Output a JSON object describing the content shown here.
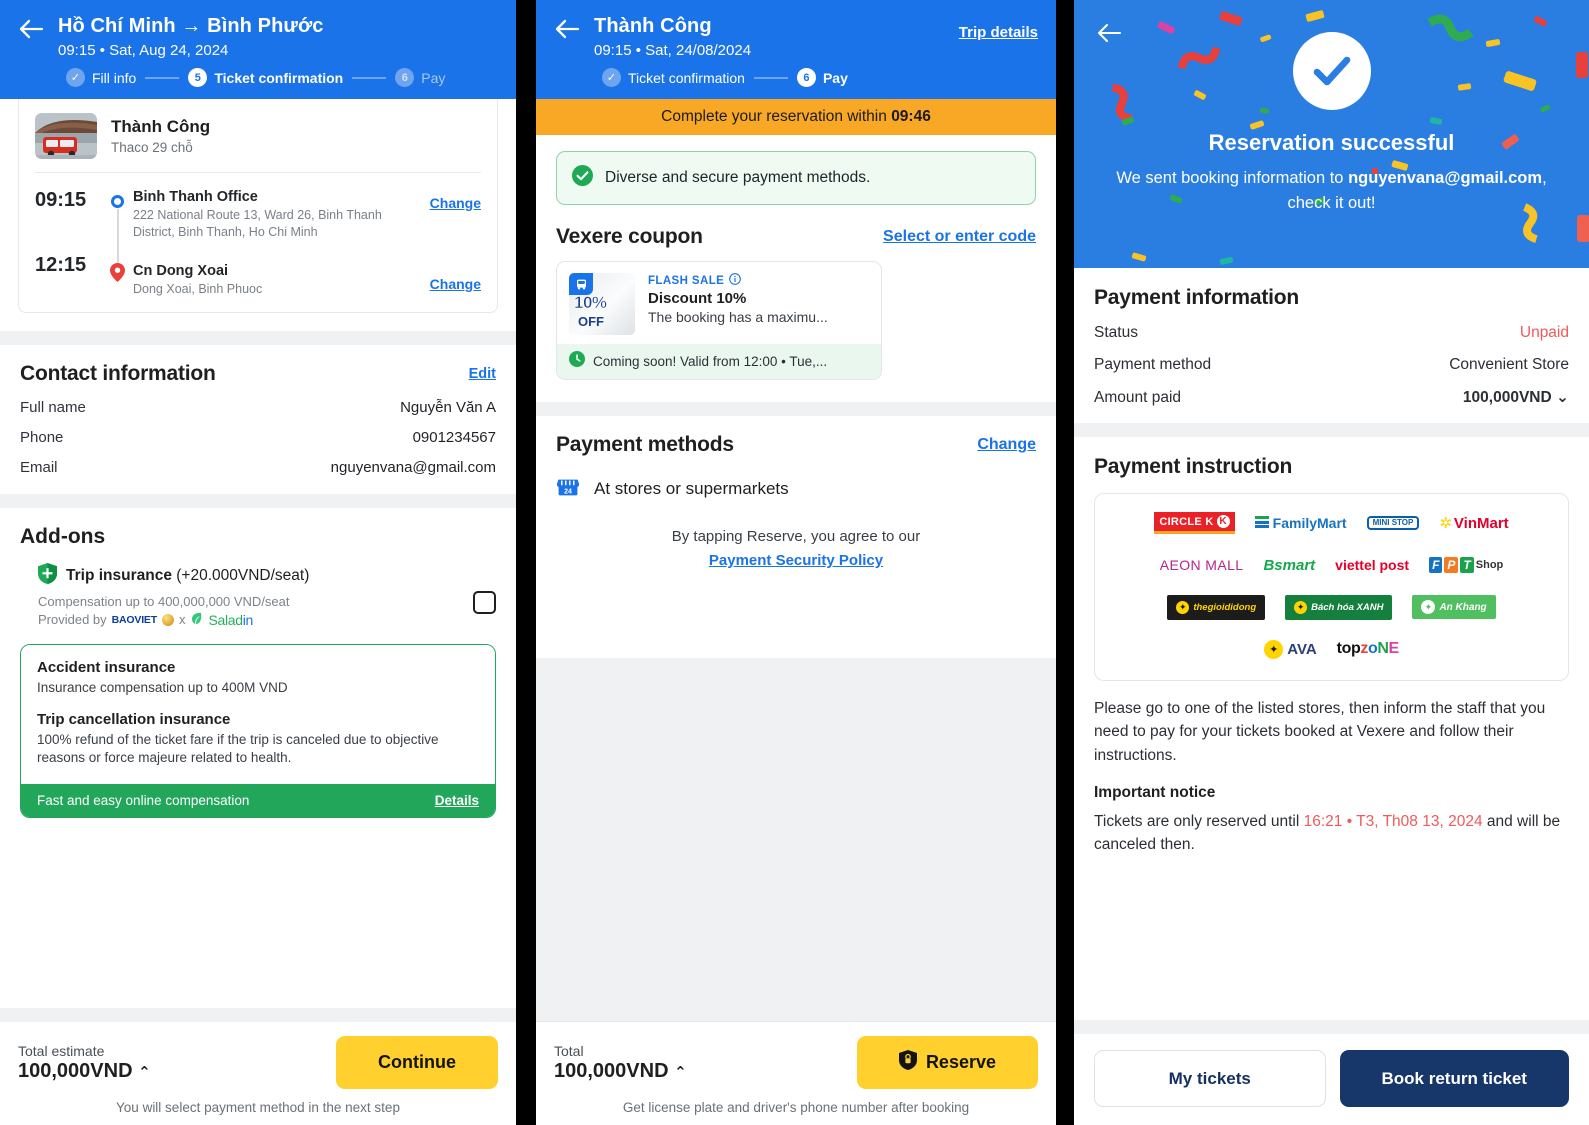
{
  "panel1": {
    "header": {
      "title": "Hồ Chí Minh → Bình Phước",
      "subtitle": "09:15 • Sat, Aug 24, 2024",
      "back_icon": "back-arrow-icon",
      "steps": [
        {
          "label": "Fill info",
          "marker": "✓",
          "state": "done"
        },
        {
          "label": "Ticket confirmation",
          "marker": "5",
          "state": "active"
        },
        {
          "label": "Pay",
          "marker": "6",
          "state": "todo"
        }
      ]
    },
    "operator": {
      "name": "Thành Công",
      "vehicle": "Thaco 29 chỗ"
    },
    "route": {
      "pickup": {
        "time": "09:15",
        "name": "Binh Thanh Office",
        "address": "222 National Route 13, Ward 26, Binh Thanh District, Binh Thanh, Ho Chi Minh",
        "change_label": "Change"
      },
      "dropoff": {
        "time": "12:15",
        "name": "Cn Dong Xoai",
        "address": "Dong Xoai, Binh Phuoc",
        "change_label": "Change"
      }
    },
    "contact": {
      "title": "Contact information",
      "edit_label": "Edit",
      "rows": [
        {
          "key": "Full name",
          "value": "Nguyễn Văn A"
        },
        {
          "key": "Phone",
          "value": "0901234567"
        },
        {
          "key": "Email",
          "value": "nguyenvana@gmail.com"
        }
      ]
    },
    "addons": {
      "title": "Add-ons",
      "insurance": {
        "name": "Trip insurance",
        "price": "(+20.000VND/seat)",
        "compensation": "Compensation up to 400,000,000 VND/seat",
        "provided_by": "Provided by",
        "provider_1": "BAOVIET",
        "provider_x": "x",
        "provider_2a": "Salad",
        "provider_2b": "in",
        "checked": false
      },
      "card": {
        "accident_title": "Accident insurance",
        "accident_desc": "Insurance compensation up to 400M VND",
        "cancel_title": "Trip cancellation insurance",
        "cancel_desc": "100% refund of the ticket fare if the trip is canceled due to objective reasons or force majeure related to health.",
        "footer_text": "Fast and easy online compensation",
        "footer_link": "Details"
      }
    },
    "bottom": {
      "total_label": "Total estimate",
      "total_value": "100,000VND",
      "caret": "⌃",
      "cta": "Continue",
      "note": "You will select payment method in the next step"
    }
  },
  "panel2": {
    "header": {
      "title": "Thành Công",
      "subtitle": "09:15 • Sat, 24/08/2024",
      "trip_details": "Trip details",
      "steps": [
        {
          "label": "Ticket confirmation",
          "marker": "✓",
          "state": "done"
        },
        {
          "label": "Pay",
          "marker": "6",
          "state": "active"
        }
      ]
    },
    "timer": {
      "text": "Complete your reservation within",
      "value": "09:46"
    },
    "secure_note": "Diverse and secure payment methods.",
    "coupon": {
      "title": "Vexere coupon",
      "action": "Select or enter code",
      "badge_pct": "10%",
      "badge_off": "OFF",
      "flash": "FLASH SALE",
      "name": "Discount 10%",
      "desc": "The booking has a maximu...",
      "valid": "Coming soon! Valid from 12:00 • Tue,..."
    },
    "payment_methods": {
      "title": "Payment methods",
      "change": "Change",
      "selected": "At stores or supermarkets"
    },
    "agreement": {
      "text": "By tapping Reserve, you agree to our",
      "link": "Payment Security Policy"
    },
    "bottom": {
      "total_label": "Total",
      "total_value": "100,000VND",
      "caret": "⌃",
      "cta": "Reserve",
      "note": "Get license plate and driver's phone number after booking"
    }
  },
  "panel3": {
    "hero": {
      "heading": "Reservation successful",
      "message_pre": "We sent booking information to ",
      "email": "nguyenvana@gmail.com",
      "message_post": ",",
      "message_line2": "check it out!",
      "check_icon": "check-circle-icon",
      "back_icon": "back-arrow-icon"
    },
    "payment_info": {
      "title": "Payment information",
      "rows": [
        {
          "key": "Status",
          "value": "Unpaid",
          "style": "unpaid"
        },
        {
          "key": "Payment method",
          "value": "Convenient Store",
          "style": "normal"
        },
        {
          "key": "Amount paid",
          "value": "100,000VND",
          "style": "bold",
          "caret": "⌄"
        }
      ]
    },
    "instruction": {
      "title": "Payment instruction",
      "stores_row1": [
        "CIRCLE K",
        "FamilyMart",
        "MINI STOP",
        "VinMart"
      ],
      "stores_row2": [
        "AEON MALL",
        "Bsmart",
        "viettel post",
        "FPT Shop"
      ],
      "stores_row3": [
        "thegioididong",
        "Bách hóa XANH",
        "An Khang"
      ],
      "stores_row4": [
        "AVA",
        "topzone"
      ],
      "body": "Please go to one of the listed stores, then inform the staff that you need to pay for your tickets booked at Vexere and follow their instructions.",
      "notice_title": "Important notice",
      "notice_pre": "Tickets are only reserved until ",
      "notice_time": "16:21 • T3, Th08 13, 2024",
      "notice_post": " and will be canceled then."
    },
    "bottom": {
      "secondary": "My tickets",
      "primary": "Book return ticket"
    }
  },
  "colors": {
    "brand_blue": "#1a73e8",
    "hero_blue": "#2a7de1",
    "amber": "#f9a825",
    "yellow": "#ffd02e",
    "green": "#22a75a",
    "red": "#f05a5a",
    "navy": "#17376b"
  }
}
